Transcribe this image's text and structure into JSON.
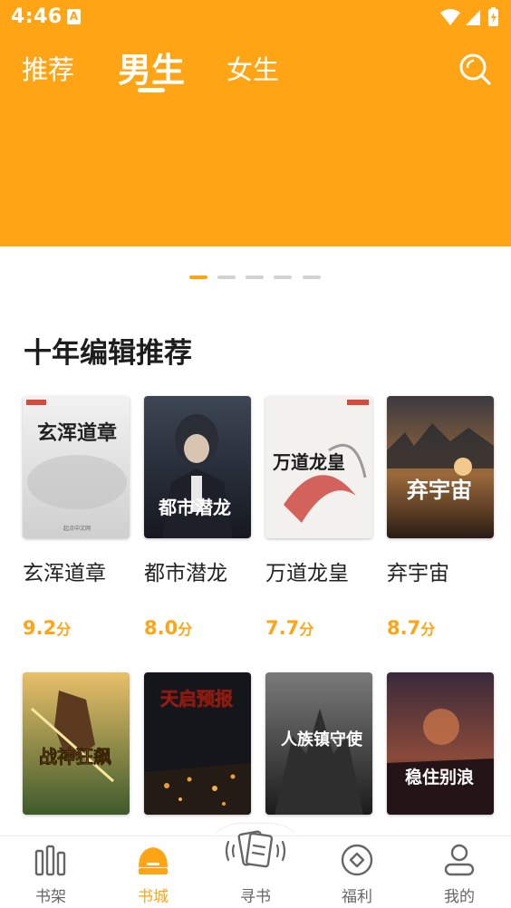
{
  "status_bar": {
    "time": "4:46",
    "notification_letter": "A"
  },
  "tabs": [
    {
      "label": "推荐",
      "active": false
    },
    {
      "label": "男生",
      "active": true
    },
    {
      "label": "女生",
      "active": false
    }
  ],
  "colors": {
    "accent": "#ffa515",
    "text": "#222222",
    "muted": "#666666",
    "indicator_inactive": "#d2d2d2"
  },
  "banner": {
    "page_count": 5,
    "active_page": 1
  },
  "section": {
    "title": "十年编辑推荐",
    "books": [
      {
        "title": "玄浑道章",
        "score": "9.2",
        "unit": "分",
        "cover_text": "玄浑道章"
      },
      {
        "title": "都市潜龙",
        "score": "8.0",
        "unit": "分",
        "cover_text": "都市潜龙"
      },
      {
        "title": "万道龙皇",
        "score": "7.7",
        "unit": "分",
        "cover_text": "万道龙皇"
      },
      {
        "title": "弃宇宙",
        "score": "8.7",
        "unit": "分",
        "cover_text": "弃宇宙"
      },
      {
        "title": "",
        "score": "",
        "unit": "",
        "cover_text": "战神狂飙"
      },
      {
        "title": "",
        "score": "",
        "unit": "",
        "cover_text": "天启预报"
      },
      {
        "title": "",
        "score": "",
        "unit": "",
        "cover_text": "人族镇守使"
      },
      {
        "title": "",
        "score": "",
        "unit": "",
        "cover_text": "稳住别浪"
      }
    ]
  },
  "bottom_nav": [
    {
      "label": "书架",
      "icon": "bookshelf-icon",
      "active": false
    },
    {
      "label": "书城",
      "icon": "bookstore-icon",
      "active": true
    },
    {
      "label": "寻书",
      "icon": "find-book-icon",
      "active": false
    },
    {
      "label": "福利",
      "icon": "welfare-icon",
      "active": false
    },
    {
      "label": "我的",
      "icon": "profile-icon",
      "active": false
    }
  ]
}
